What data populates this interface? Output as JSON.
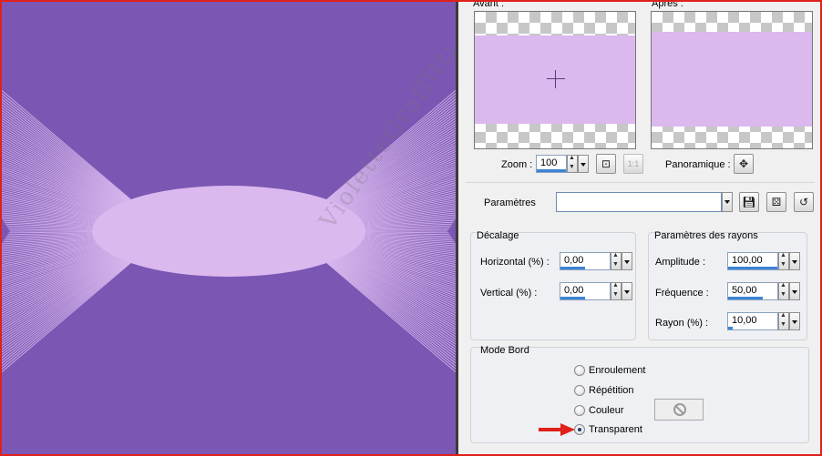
{
  "previews": {
    "before_label": "Avant :",
    "after_label": "Après :"
  },
  "zoom": {
    "label": "Zoom :",
    "value": "100",
    "pan_label": "Panoramique :"
  },
  "presets": {
    "label": "Paramètres",
    "value": ""
  },
  "offset_group": {
    "title": "Décalage",
    "horizontal_label": "Horizontal (%) :",
    "horizontal_value": "0,00",
    "vertical_label": "Vertical (%) :",
    "vertical_value": "0,00"
  },
  "ray_group": {
    "title": "Paramètres des rayons",
    "amplitude_label": "Amplitude :",
    "amplitude_value": "100,00",
    "frequency_label": "Fréquence :",
    "frequency_value": "50,00",
    "radius_label": "Rayon (%) :",
    "radius_value": "10,00"
  },
  "edge_mode": {
    "title": "Mode Bord",
    "options": [
      "Enroulement",
      "Répétition",
      "Couleur",
      "Transparent"
    ],
    "selected": "Transparent"
  },
  "watermark": "VioletteGraffitti",
  "colors": {
    "canvas_background": "#7b57b3",
    "shape_fill": "#dbb8ee",
    "highlight_arrow": "#e0201a",
    "frame_border": "#e0201a"
  }
}
